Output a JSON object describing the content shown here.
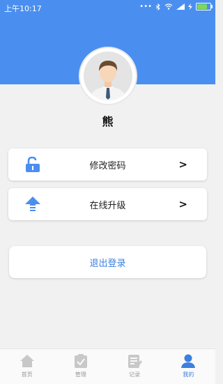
{
  "status": {
    "time": "上午10:17",
    "icons": [
      "dots-icon",
      "bluetooth-icon",
      "wifi-icon",
      "signal-icon",
      "battery-icon"
    ]
  },
  "profile": {
    "name": "熊"
  },
  "menu": [
    {
      "label": "修改密码",
      "icon": "unlock-icon",
      "arrow": ">"
    },
    {
      "label": "在线升级",
      "icon": "upgrade-icon",
      "arrow": ">"
    }
  ],
  "logout": {
    "label": "退出登录"
  },
  "tabs": [
    {
      "label": "首页",
      "icon": "home-icon"
    },
    {
      "label": "管理",
      "icon": "clipboard-check-icon"
    },
    {
      "label": "记录",
      "icon": "notes-icon"
    },
    {
      "label": "我的",
      "icon": "user-icon"
    }
  ],
  "colors": {
    "primary": "#4a8ff0",
    "accent": "#3b7fe0",
    "tabInactive": "#c8c8c8"
  }
}
